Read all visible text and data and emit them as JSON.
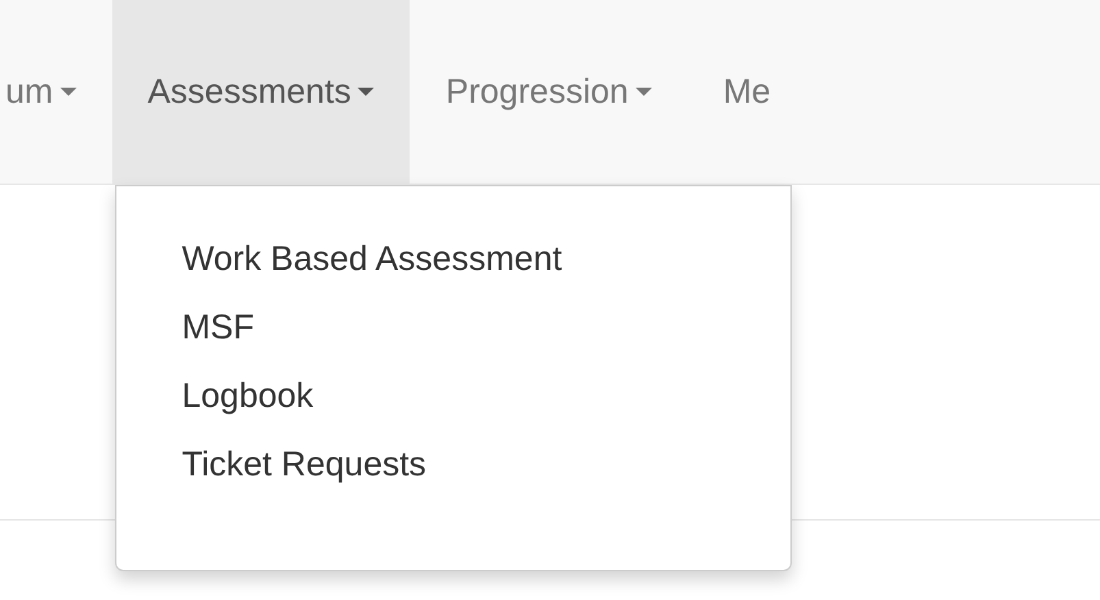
{
  "nav_items": [
    {
      "label": "um",
      "selected": false
    },
    {
      "label": "Assessments",
      "selected": true,
      "menu": [
        {
          "label": "Work Based Assessment"
        },
        {
          "label": "MSF"
        },
        {
          "label": "Logbook"
        },
        {
          "label": "Ticket Requests"
        }
      ]
    },
    {
      "label": "Progression",
      "selected": false
    },
    {
      "label": "Me",
      "selected": false
    }
  ]
}
